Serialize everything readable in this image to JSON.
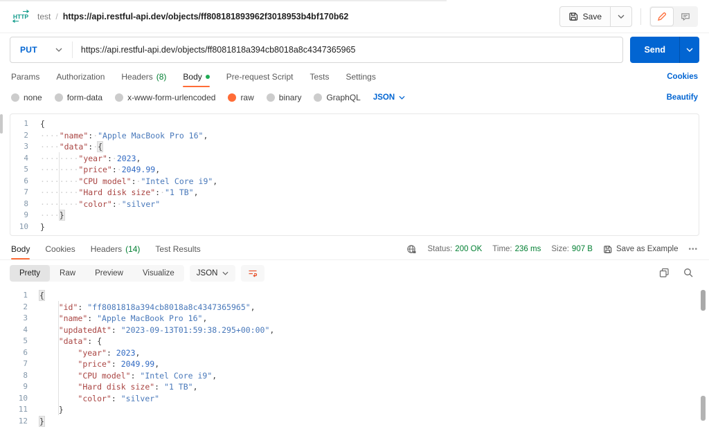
{
  "colors": {
    "accent_orange": "#ff6c37",
    "link_blue": "#0265d2",
    "success_green": "#007f31",
    "brand_teal": "#0f9a8a",
    "key_red": "#a94442",
    "value_blue": "#4878ba"
  },
  "header": {
    "http_badge": "HTTP",
    "collection_name": "test",
    "separator": "/",
    "request_title": "https://api.restful-api.dev/objects/ff808181893962f3018953b4bf170b62",
    "save_label": "Save"
  },
  "request_bar": {
    "method": "PUT",
    "url": "https://api.restful-api.dev/objects/ff8081818a394cb8018a8c4347365965",
    "send_label": "Send"
  },
  "request_tabs": {
    "params": "Params",
    "authorization": "Authorization",
    "headers": "Headers",
    "headers_count": "(8)",
    "body": "Body",
    "prerequest": "Pre-request Script",
    "tests": "Tests",
    "settings": "Settings",
    "cookies_link": "Cookies"
  },
  "body_type_bar": {
    "options": [
      "none",
      "form-data",
      "x-www-form-urlencoded",
      "raw",
      "binary",
      "GraphQL"
    ],
    "selected": "raw",
    "language": "JSON",
    "beautify_link": "Beautify"
  },
  "request_editor": {
    "lines": [
      [
        [
          "p",
          "{"
        ]
      ],
      [
        [
          "w",
          "····"
        ],
        [
          "k",
          "\"name\""
        ],
        [
          "p",
          ":"
        ],
        [
          "w",
          "·"
        ],
        [
          "s",
          "\"Apple MacBook Pro 16\""
        ],
        [
          "p",
          ","
        ]
      ],
      [
        [
          "w",
          "····"
        ],
        [
          "k",
          "\"data\""
        ],
        [
          "p",
          ":"
        ],
        [
          "w",
          "·"
        ],
        [
          "b",
          "{"
        ]
      ],
      [
        [
          "w",
          "········"
        ],
        [
          "k",
          "\"year\""
        ],
        [
          "p",
          ":"
        ],
        [
          "w",
          "·"
        ],
        [
          "n",
          "2023"
        ],
        [
          "p",
          ","
        ]
      ],
      [
        [
          "w",
          "········"
        ],
        [
          "k",
          "\"price\""
        ],
        [
          "p",
          ":"
        ],
        [
          "w",
          "·"
        ],
        [
          "n",
          "2049.99"
        ],
        [
          "p",
          ","
        ]
      ],
      [
        [
          "w",
          "········"
        ],
        [
          "k",
          "\"CPU model\""
        ],
        [
          "p",
          ":"
        ],
        [
          "w",
          "·"
        ],
        [
          "s",
          "\"Intel Core i9\""
        ],
        [
          "p",
          ","
        ]
      ],
      [
        [
          "w",
          "········"
        ],
        [
          "k",
          "\"Hard disk size\""
        ],
        [
          "p",
          ":"
        ],
        [
          "w",
          "·"
        ],
        [
          "s",
          "\"1 TB\""
        ],
        [
          "p",
          ","
        ]
      ],
      [
        [
          "w",
          "········"
        ],
        [
          "k",
          "\"color\""
        ],
        [
          "p",
          ":"
        ],
        [
          "w",
          "·"
        ],
        [
          "s",
          "\"silver\""
        ]
      ],
      [
        [
          "w",
          "····"
        ],
        [
          "b",
          "}"
        ]
      ],
      [
        [
          "p",
          "}"
        ]
      ]
    ]
  },
  "response_meta": {
    "tabs": {
      "body": "Body",
      "cookies": "Cookies",
      "headers": "Headers",
      "headers_count": "(14)",
      "test_results": "Test Results"
    },
    "status_label": "Status:",
    "status_value": "200 OK",
    "time_label": "Time:",
    "time_value": "236 ms",
    "size_label": "Size:",
    "size_value": "907 B",
    "save_as_example": "Save as Example",
    "more_menu": "•••"
  },
  "response_toolbar": {
    "views": [
      "Pretty",
      "Raw",
      "Preview",
      "Visualize"
    ],
    "active_view": "Pretty",
    "language": "JSON"
  },
  "response_editor": {
    "lines": [
      [
        [
          "b",
          "{"
        ]
      ],
      [
        [
          "p",
          "    "
        ],
        [
          "k",
          "\"id\""
        ],
        [
          "p",
          ": "
        ],
        [
          "s",
          "\"ff8081818a394cb8018a8c4347365965\""
        ],
        [
          "p",
          ","
        ]
      ],
      [
        [
          "p",
          "    "
        ],
        [
          "k",
          "\"name\""
        ],
        [
          "p",
          ": "
        ],
        [
          "s",
          "\"Apple MacBook Pro 16\""
        ],
        [
          "p",
          ","
        ]
      ],
      [
        [
          "p",
          "    "
        ],
        [
          "k",
          "\"updatedAt\""
        ],
        [
          "p",
          ": "
        ],
        [
          "s",
          "\"2023-09-13T01:59:38.295+00:00\""
        ],
        [
          "p",
          ","
        ]
      ],
      [
        [
          "p",
          "    "
        ],
        [
          "k",
          "\"data\""
        ],
        [
          "p",
          ": "
        ],
        [
          "p",
          "{"
        ]
      ],
      [
        [
          "p",
          "        "
        ],
        [
          "k",
          "\"year\""
        ],
        [
          "p",
          ": "
        ],
        [
          "n",
          "2023"
        ],
        [
          "p",
          ","
        ]
      ],
      [
        [
          "p",
          "        "
        ],
        [
          "k",
          "\"price\""
        ],
        [
          "p",
          ": "
        ],
        [
          "n",
          "2049.99"
        ],
        [
          "p",
          ","
        ]
      ],
      [
        [
          "p",
          "        "
        ],
        [
          "k",
          "\"CPU model\""
        ],
        [
          "p",
          ": "
        ],
        [
          "s",
          "\"Intel Core i9\""
        ],
        [
          "p",
          ","
        ]
      ],
      [
        [
          "p",
          "        "
        ],
        [
          "k",
          "\"Hard disk size\""
        ],
        [
          "p",
          ": "
        ],
        [
          "s",
          "\"1 TB\""
        ],
        [
          "p",
          ","
        ]
      ],
      [
        [
          "p",
          "        "
        ],
        [
          "k",
          "\"color\""
        ],
        [
          "p",
          ": "
        ],
        [
          "s",
          "\"silver\""
        ]
      ],
      [
        [
          "p",
          "    "
        ],
        [
          "p",
          "}"
        ]
      ],
      [
        [
          "b",
          "}"
        ]
      ]
    ]
  }
}
